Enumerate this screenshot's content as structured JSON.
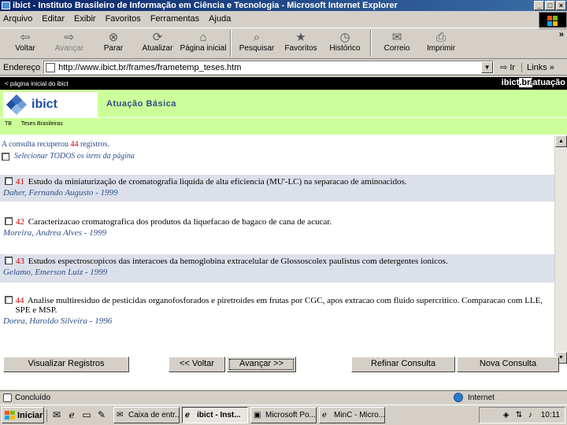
{
  "window": {
    "title": "ibict - Instituto Brasileiro de Informação em Ciência e Tecnologia - Microsoft Internet Explorer"
  },
  "menu": [
    "Arquivo",
    "Editar",
    "Exibir",
    "Favoritos",
    "Ferramentas",
    "Ajuda"
  ],
  "toolbar": {
    "back": "Voltar",
    "forward": "Avançar",
    "stop": "Parar",
    "refresh": "Atualizar",
    "home": "Página inicial",
    "search": "Pesquisar",
    "favorites": "Favoritos",
    "history": "Histórico",
    "mail": "Correio",
    "print": "Imprimir",
    "more": "»"
  },
  "address": {
    "label": "Endereço",
    "url": "http://www.ibict.br/frames/frametemp_teses.htm",
    "go": "Ir",
    "links": "Links"
  },
  "page": {
    "top_link": "< página inicial do ibict",
    "site_tag_prefix": "ibict",
    "site_tag_highlight": ".br/",
    "site_tag_suffix": "atuação",
    "logo_text": "ibict",
    "section_title": "Atuação Básica",
    "subnav": [
      "TB",
      "Teses Brasileiras"
    ],
    "summary_before": "A consulta recuperou",
    "summary_count": "44",
    "summary_after": "registros.",
    "select_all": "Selecionar TODOS os itens da página",
    "results": [
      {
        "num": "41",
        "title": "Estudo da miniaturização de cromatografia liquida de alta eficiencia (MU'-LC) na separacao de aminoacidos.",
        "author": "Daher, Fernando Augusto - 1999"
      },
      {
        "num": "42",
        "title": "Caracterizacao cromatografica dos produtos da liquefacao de bagaco de cana de acucar.",
        "author": "Moreira, Andrea Alves - 1999"
      },
      {
        "num": "43",
        "title": "Estudos espectroscopicos das interacoes da hemoglobina extracelular de Glossoscolex paulistus com detergentes ionicos.",
        "author": "Gelamo, Emerson Luiz - 1999"
      },
      {
        "num": "44",
        "title": "Analise multiresiduo de pesticidas organofosforados e piretroides em frutas por CGC, apos extracao com fluido supercritico. Comparacao com LLE, SPE e MSP.",
        "author": "Dorea, Haroldo Silveira - 1996"
      }
    ],
    "buttons": {
      "view": "Visualizar Registros",
      "back": "<< Voltar",
      "next": "Avançar >>",
      "refine": "Refinar Consulta",
      "new": "Nova Consulta"
    }
  },
  "status": {
    "text": "Concluído",
    "zone": "Internet"
  },
  "taskbar": {
    "start": "Iniciar",
    "tasks": [
      "Caixa de entr...",
      "ibict - Inst...",
      "Microsoft Po...",
      "MinC - Micro..."
    ],
    "clock": "10:11"
  },
  "colors": {
    "header_green": "#ccff99",
    "result_number": "#cc0000",
    "link_blue": "#2d4d8a",
    "ibict_blue": "#1b4fa0"
  }
}
